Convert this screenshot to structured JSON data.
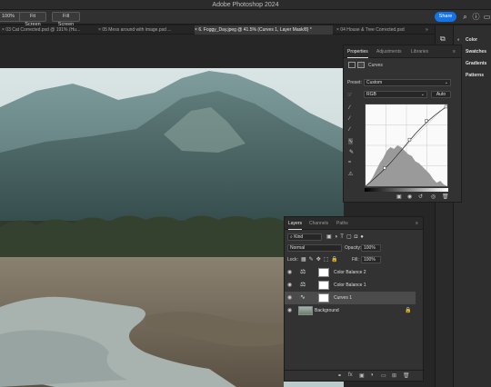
{
  "app": {
    "title": "Adobe Photoshop 2024"
  },
  "options": {
    "zoom_label": "100%",
    "fit_screen": "Fit Screen",
    "fill_screen": "Fill Screen",
    "share": "Share"
  },
  "tabs": [
    {
      "label": "03 Cat Corrected.psd @ 191% (Hu..."
    },
    {
      "label": "05 Mess around with image.psd ..."
    },
    {
      "label": "6. Foggy_Day.jpeg @ 41.5% (Curves 1, Layer Mask/8) *"
    },
    {
      "label": "04 House & Tree Corrected.psd"
    }
  ],
  "right_panels": [
    "Color",
    "Swatches",
    "Gradients",
    "Patterns"
  ],
  "properties": {
    "tabs": [
      "Properties",
      "Adjustments",
      "Libraries"
    ],
    "type": "Curves",
    "preset_label": "Preset:",
    "preset_value": "Custom",
    "channel": "RGB",
    "auto": "Auto"
  },
  "layers": {
    "tabs": [
      "Layers",
      "Channels",
      "Paths"
    ],
    "filter": "Kind",
    "blend": "Normal",
    "opacity_label": "Opacity:",
    "opacity": "100%",
    "lock_label": "Lock:",
    "fill_label": "Fill:",
    "fill": "100%",
    "items": [
      {
        "name": "Color Balance 2",
        "icon": "balance-icon",
        "selected": false
      },
      {
        "name": "Color Balance 1",
        "icon": "balance-icon",
        "selected": false
      },
      {
        "name": "Curves 1",
        "icon": "curves-icon",
        "selected": true
      },
      {
        "name": "Background",
        "icon": "image-thumb",
        "selected": false
      }
    ]
  }
}
